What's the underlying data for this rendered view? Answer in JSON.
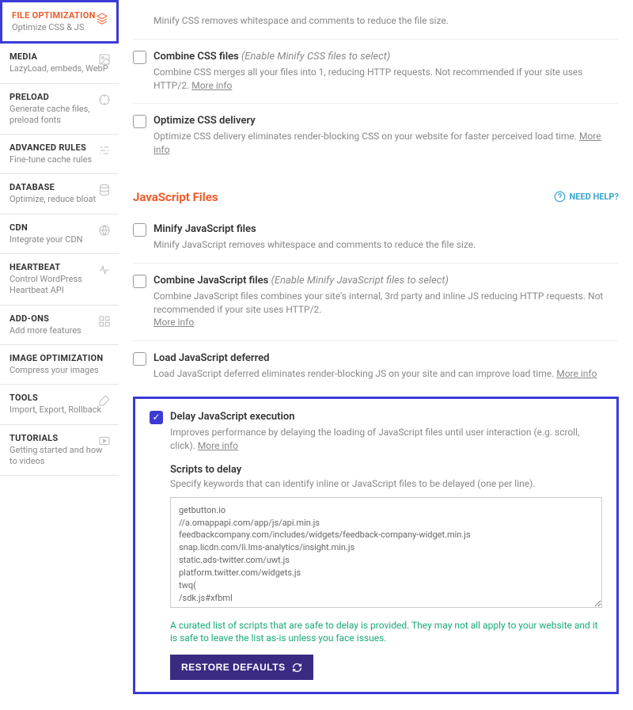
{
  "sidebar": [
    {
      "title": "FILE OPTIMIZATION",
      "sub": "Optimize CSS & JS",
      "active": true
    },
    {
      "title": "MEDIA",
      "sub": "LazyLoad, embeds, WebP"
    },
    {
      "title": "PRELOAD",
      "sub": "Generate cache files, preload fonts"
    },
    {
      "title": "ADVANCED RULES",
      "sub": "Fine-tune cache rules"
    },
    {
      "title": "DATABASE",
      "sub": "Optimize, reduce bloat"
    },
    {
      "title": "CDN",
      "sub": "Integrate your CDN"
    },
    {
      "title": "HEARTBEAT",
      "sub": "Control WordPress Heartbeat API"
    },
    {
      "title": "ADD-ONS",
      "sub": "Add more features"
    },
    {
      "title": "IMAGE OPTIMIZATION",
      "sub": "Compress your images"
    },
    {
      "title": "TOOLS",
      "sub": "Import, Export, Rollback"
    },
    {
      "title": "TUTORIALS",
      "sub": "Getting started and how to videos"
    }
  ],
  "css": {
    "minify_desc": "Minify CSS removes whitespace and comments to reduce the file size.",
    "combine_label": "Combine CSS files",
    "combine_hint": "(Enable Minify CSS files to select)",
    "combine_desc": "Combine CSS merges all your files into 1, reducing HTTP requests. Not recommended if your site uses HTTP/2.",
    "delivery_label": "Optimize CSS delivery",
    "delivery_desc": "Optimize CSS delivery eliminates render-blocking CSS on your website for faster perceived load time."
  },
  "js_section": {
    "title": "JavaScript Files",
    "need_help": "NEED HELP?"
  },
  "js": {
    "minify_label": "Minify JavaScript files",
    "minify_desc": "Minify JavaScript removes whitespace and comments to reduce the file size.",
    "combine_label": "Combine JavaScript files",
    "combine_hint": "(Enable Minify JavaScript files to select)",
    "combine_desc": "Combine JavaScript files combines your site's internal, 3rd party and inline JS reducing HTTP requests. Not recommended if your site uses HTTP/2.",
    "defer_label": "Load JavaScript deferred",
    "defer_desc": "Load JavaScript deferred eliminates render-blocking JS on your site and can improve load time.",
    "delay_label": "Delay JavaScript execution",
    "delay_desc": "Improves performance by delaying the loading of JavaScript files until user interaction (e.g. scroll, click).",
    "scripts_label": "Scripts to delay",
    "scripts_desc": "Specify keywords that can identify inline or JavaScript files to be delayed (one per line).",
    "scripts_value": "getbutton.io\n//a.omappapi.com/app/js/api.min.js\nfeedbackcompany.com/includes/widgets/feedback-company-widget.min.js\nsnap.licdn.com/li.lms-analytics/insight.min.js\nstatic.ads-twitter.com/uwt.js\nplatform.twitter.com/widgets.js\ntwq(\n/sdk.js#xfbml\nstatic.leadpages.net/leadbars/current/embed.js\ntranslate.google.com/translate_a/element.js\nwidget.manychat.com\nxfbml.customerchat.js",
    "curated_note": "A curated list of scripts that are safe to delay is provided. They may not all apply to your website and it is safe to leave the list as-is unless you face issues.",
    "restore_btn": "RESTORE DEFAULTS"
  },
  "more_info": "More info"
}
